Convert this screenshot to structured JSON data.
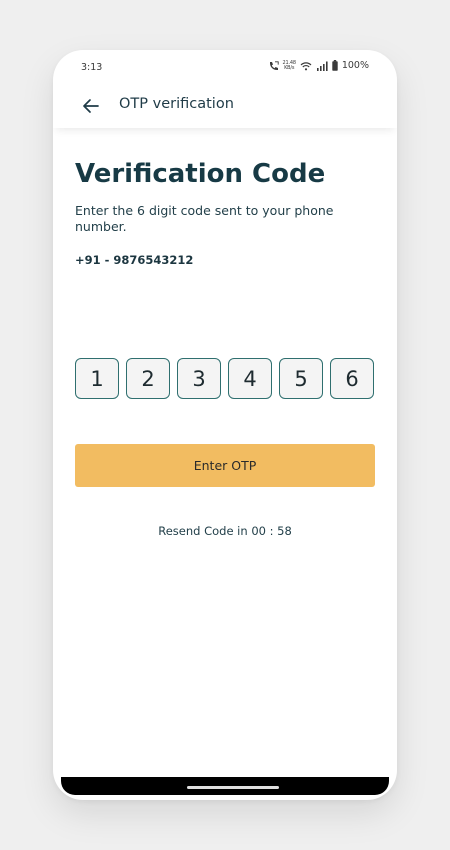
{
  "status": {
    "time": "3:13",
    "speed_value": "21.48",
    "speed_unit": "KB/s",
    "battery": "100%"
  },
  "appbar": {
    "title": "OTP verification"
  },
  "main": {
    "heading": "Verification Code",
    "instruction": "Enter the 6 digit code sent to your phone number.",
    "phone_number": "+91 - 9876543212",
    "otp_digits": [
      "1",
      "2",
      "3",
      "4",
      "5",
      "6"
    ],
    "enter_button": "Enter OTP",
    "resend_text": "Resend Code in 00 : 58"
  },
  "colors": {
    "accent": "#f2bc61",
    "primary_text": "#173a45",
    "otp_border": "#2f6f6f"
  },
  "icons": [
    "back-arrow-icon",
    "call-icon",
    "wifi-icon",
    "signal-icon",
    "battery-icon"
  ]
}
